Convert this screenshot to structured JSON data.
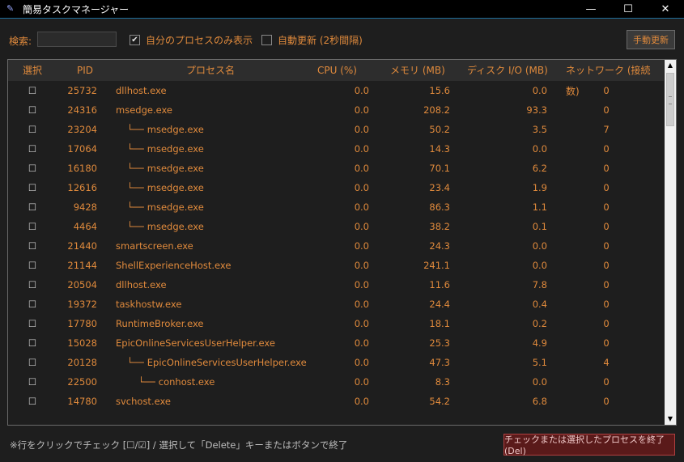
{
  "window": {
    "title": "簡易タスクマネージャー",
    "controls": {
      "minimize": "—",
      "maximize": "☐",
      "close": "✕"
    }
  },
  "toolbar": {
    "search_label": "検索:",
    "search_value": "",
    "own_process_checkbox": {
      "checked": true,
      "label": "自分のプロセスのみ表示"
    },
    "auto_refresh_checkbox": {
      "checked": false,
      "label": "自動更新 (2秒間隔)"
    },
    "manual_refresh_label": "手動更新"
  },
  "table": {
    "columns": [
      "選択",
      "PID",
      "プロセス名",
      "CPU (%)",
      "メモリ (MB)",
      "ディスク I/O (MB)",
      "ネットワーク (接続数)"
    ],
    "rows": [
      {
        "sel": "☐",
        "pid": "25732",
        "tree": "",
        "name": "dllhost.exe",
        "cpu": "0.0",
        "mem": "15.6",
        "disk": "0.0",
        "net": "0"
      },
      {
        "sel": "☐",
        "pid": "24316",
        "tree": "",
        "name": "msedge.exe",
        "cpu": "0.0",
        "mem": "208.2",
        "disk": "93.3",
        "net": "0"
      },
      {
        "sel": "☐",
        "pid": "23204",
        "tree": "└──",
        "name": "msedge.exe",
        "cpu": "0.0",
        "mem": "50.2",
        "disk": "3.5",
        "net": "7"
      },
      {
        "sel": "☐",
        "pid": "17064",
        "tree": "└──",
        "name": "msedge.exe",
        "cpu": "0.0",
        "mem": "14.3",
        "disk": "0.0",
        "net": "0"
      },
      {
        "sel": "☐",
        "pid": "16180",
        "tree": "└──",
        "name": "msedge.exe",
        "cpu": "0.0",
        "mem": "70.1",
        "disk": "6.2",
        "net": "0"
      },
      {
        "sel": "☐",
        "pid": "12616",
        "tree": "└──",
        "name": "msedge.exe",
        "cpu": "0.0",
        "mem": "23.4",
        "disk": "1.9",
        "net": "0"
      },
      {
        "sel": "☐",
        "pid": "9428",
        "tree": "└──",
        "name": "msedge.exe",
        "cpu": "0.0",
        "mem": "86.3",
        "disk": "1.1",
        "net": "0"
      },
      {
        "sel": "☐",
        "pid": "4464",
        "tree": "└──",
        "name": "msedge.exe",
        "cpu": "0.0",
        "mem": "38.2",
        "disk": "0.1",
        "net": "0"
      },
      {
        "sel": "☐",
        "pid": "21440",
        "tree": "",
        "name": "smartscreen.exe",
        "cpu": "0.0",
        "mem": "24.3",
        "disk": "0.0",
        "net": "0"
      },
      {
        "sel": "☐",
        "pid": "21144",
        "tree": "",
        "name": "ShellExperienceHost.exe",
        "cpu": "0.0",
        "mem": "241.1",
        "disk": "0.0",
        "net": "0"
      },
      {
        "sel": "☐",
        "pid": "20504",
        "tree": "",
        "name": "dllhost.exe",
        "cpu": "0.0",
        "mem": "11.6",
        "disk": "7.8",
        "net": "0"
      },
      {
        "sel": "☐",
        "pid": "19372",
        "tree": "",
        "name": "taskhostw.exe",
        "cpu": "0.0",
        "mem": "24.4",
        "disk": "0.4",
        "net": "0"
      },
      {
        "sel": "☐",
        "pid": "17780",
        "tree": "",
        "name": "RuntimeBroker.exe",
        "cpu": "0.0",
        "mem": "18.1",
        "disk": "0.2",
        "net": "0"
      },
      {
        "sel": "☐",
        "pid": "15028",
        "tree": "",
        "name": "EpicOnlineServicesUserHelper.exe",
        "cpu": "0.0",
        "mem": "25.3",
        "disk": "4.9",
        "net": "0"
      },
      {
        "sel": "☐",
        "pid": "20128",
        "tree": "└──",
        "name": "EpicOnlineServicesUserHelper.exe",
        "cpu": "0.0",
        "mem": "47.3",
        "disk": "5.1",
        "net": "4"
      },
      {
        "sel": "☐",
        "pid": "22500",
        "tree": "└──",
        "name": "conhost.exe",
        "cpu": "0.0",
        "mem": "8.3",
        "disk": "0.0",
        "net": "0"
      },
      {
        "sel": "☐",
        "pid": "14780",
        "tree": "",
        "name": "svchost.exe",
        "cpu": "0.0",
        "mem": "54.2",
        "disk": "6.8",
        "net": "0"
      }
    ]
  },
  "footer": {
    "hint": "※行をクリックでチェック [☐/☑] / 選択して「Delete」キーまたはボタンで終了",
    "end_button_label": "チェックまたは選択したプロセスを終了 (Del)"
  },
  "colors": {
    "accent": "#e08a3c",
    "background": "#1e1e1e",
    "danger": "#5a1a1a"
  }
}
